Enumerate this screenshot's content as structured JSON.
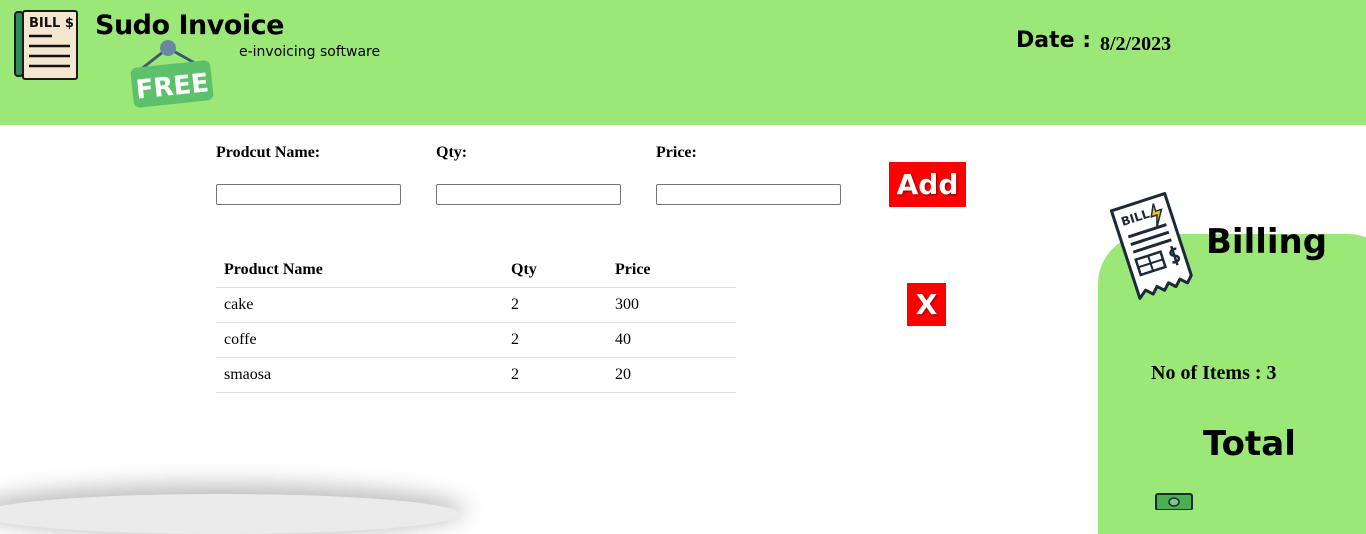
{
  "header": {
    "title": "Sudo Invoice",
    "subtitle": "e-invoicing software",
    "logo_text": "BILL $",
    "badge_text": "FREE",
    "date_label": "Date :",
    "date_value": "8/2/2023"
  },
  "form": {
    "product_label": "Prodcut Name:",
    "product_value": "",
    "qty_label": "Qty:",
    "qty_value": "",
    "price_label": "Price:",
    "price_value": "",
    "add_label": "Add",
    "clear_label": "X"
  },
  "table": {
    "headers": [
      "Product Name",
      "Qty",
      "Price"
    ],
    "rows": [
      [
        "cake",
        "2",
        "300"
      ],
      [
        "coffe",
        "2",
        "40"
      ],
      [
        "smaosa",
        "2",
        "20"
      ]
    ]
  },
  "billing": {
    "title": "Billing",
    "icon_text": "BILL",
    "items_count": "No of Items : 3",
    "total_label": "Total"
  },
  "colors": {
    "header_bg": "#9be878",
    "panel_bg": "#9be878",
    "button_bg": "#ff0000",
    "badge_bg": "#5cc16a"
  },
  "icons": [
    "bill-receipt-icon",
    "free-badge-icon",
    "billing-receipt-icon",
    "money-icon"
  ]
}
